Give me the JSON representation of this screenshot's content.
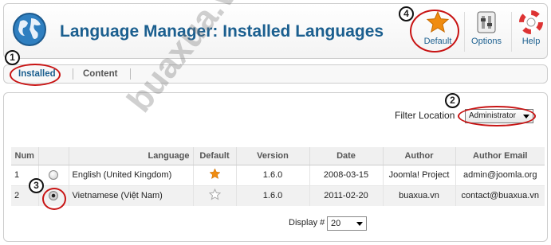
{
  "header": {
    "title": "Language Manager: Installed Languages",
    "toolbar": [
      {
        "label": "Default",
        "icon": "star-icon"
      },
      {
        "label": "Options",
        "icon": "options-icon"
      },
      {
        "label": "Help",
        "icon": "help-lifebuoy-icon"
      }
    ]
  },
  "tabs": [
    {
      "label": "Installed",
      "active": true
    },
    {
      "label": "Content",
      "active": false
    }
  ],
  "filter": {
    "label": "Filter Location",
    "value": "Administrator"
  },
  "table": {
    "columns": [
      "Num",
      "",
      "Language",
      "Default",
      "Version",
      "Date",
      "Author",
      "Author Email"
    ],
    "rows": [
      {
        "num": "1",
        "language": "English (United Kingdom)",
        "default": true,
        "version": "1.6.0",
        "date": "2008-03-15",
        "author": "Joomla! Project",
        "email": "admin@joomla.org",
        "selected": false
      },
      {
        "num": "2",
        "language": "Vietnamese (Việt Nam)",
        "default": false,
        "version": "1.6.0",
        "date": "2011-02-20",
        "author": "buaxua.vn",
        "email": "contact@buaxua.vn",
        "selected": true
      }
    ]
  },
  "pagination": {
    "label": "Display #",
    "value": "20"
  },
  "annotations": [
    "1",
    "2",
    "3",
    "4"
  ],
  "watermark": "buaxua.vn",
  "colors": {
    "accent": "#1b5f8f",
    "annotation": "#c81414",
    "star": "#f08c10"
  }
}
